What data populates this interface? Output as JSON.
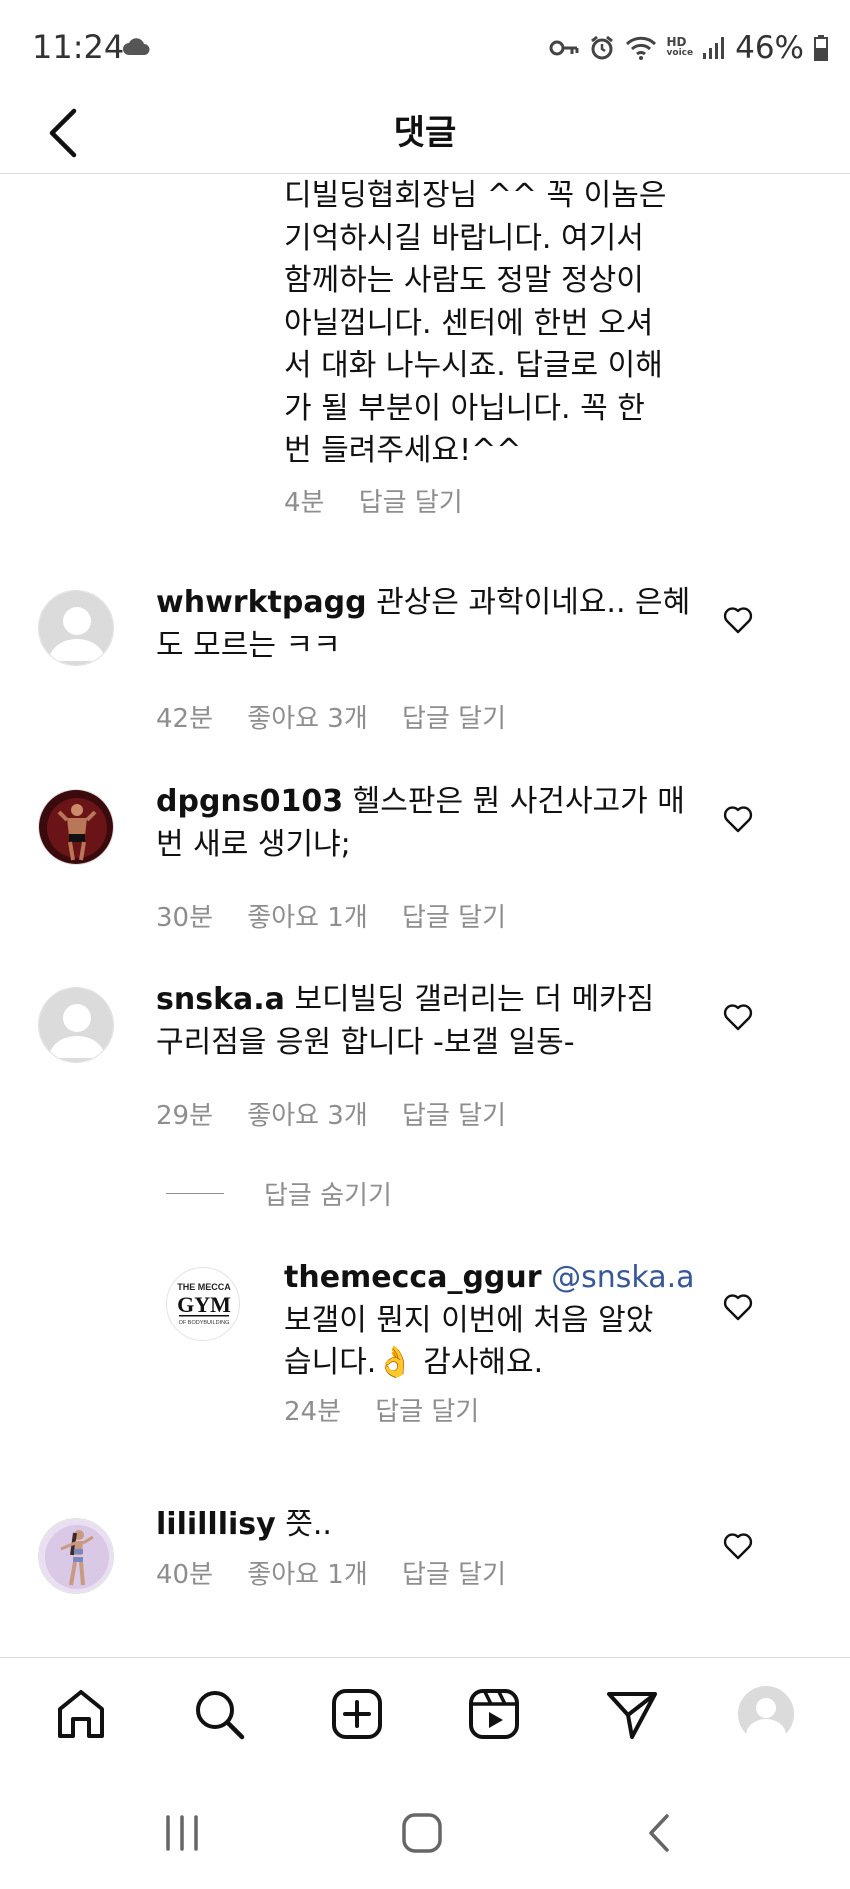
{
  "status_bar": {
    "time": "11:24",
    "battery": "46%",
    "hd_label_top": "HD",
    "hd_label_bottom": "voice"
  },
  "header": {
    "title": "댓글"
  },
  "continued_comment": {
    "lines": [
      "디빌딩협회장님 ^^ 꼭 이놈은",
      "기억하시길 바랍니다. 여기서",
      "함께하는 사람도 정말 정상이",
      "아닐껍니다. 센터에 한번 오셔",
      "서 대화 나누시죠. 답글로 이해",
      "가 될 부분이 아닙니다. 꼭 한",
      "번 들려주세요!^^"
    ],
    "time": "4분",
    "reply": "답글 달기"
  },
  "comments": [
    {
      "username": "whwrktpagg",
      "text_line1": " 관상은 과학이네요.. 은혜",
      "text_line2": "도 모르는 ㅋㅋ",
      "time": "42분",
      "likes": "좋아요 3개",
      "reply": "답글 달기"
    },
    {
      "username": "dpgns0103",
      "text_line1": " 헬스판은 뭔 사건사고가 매",
      "text_line2": "번 새로 생기냐;",
      "time": "30분",
      "likes": "좋아요 1개",
      "reply": "답글 달기"
    },
    {
      "username": "snska.a",
      "text_line1": " 보디빌딩 갤러리는 더 메카짐",
      "text_line2": "구리점을 응원 합니다 -보갤 일동-",
      "time": "29분",
      "likes": "좋아요 3개",
      "reply": "답글 달기"
    },
    {
      "username": "lililllisy",
      "text_line1": " 쯧..",
      "time": "40분",
      "likes": "좋아요 1개",
      "reply": "답글 달기"
    }
  ],
  "hide_replies": "답글 숨기기",
  "reply_comment": {
    "username": "themecca_ggur",
    "mention": " @snska.a",
    "text_line1": "보갤이 뭔지 이번에 처음 알았",
    "text_line2": "습니다.👌 감사해요.",
    "time": "24분",
    "reply": "답글 달기",
    "logo_top": "THE MECCA",
    "logo_main": "GYM",
    "logo_bottom": "OF BODYBUILDING"
  },
  "bottom_nav": [
    "home-icon",
    "search-icon",
    "create-icon",
    "reels-icon",
    "direct-icon",
    "profile-icon"
  ],
  "colors": {
    "meta_gray": "#8e8e8e",
    "mention_blue": "#385898",
    "divider": "#dbdbdb"
  }
}
